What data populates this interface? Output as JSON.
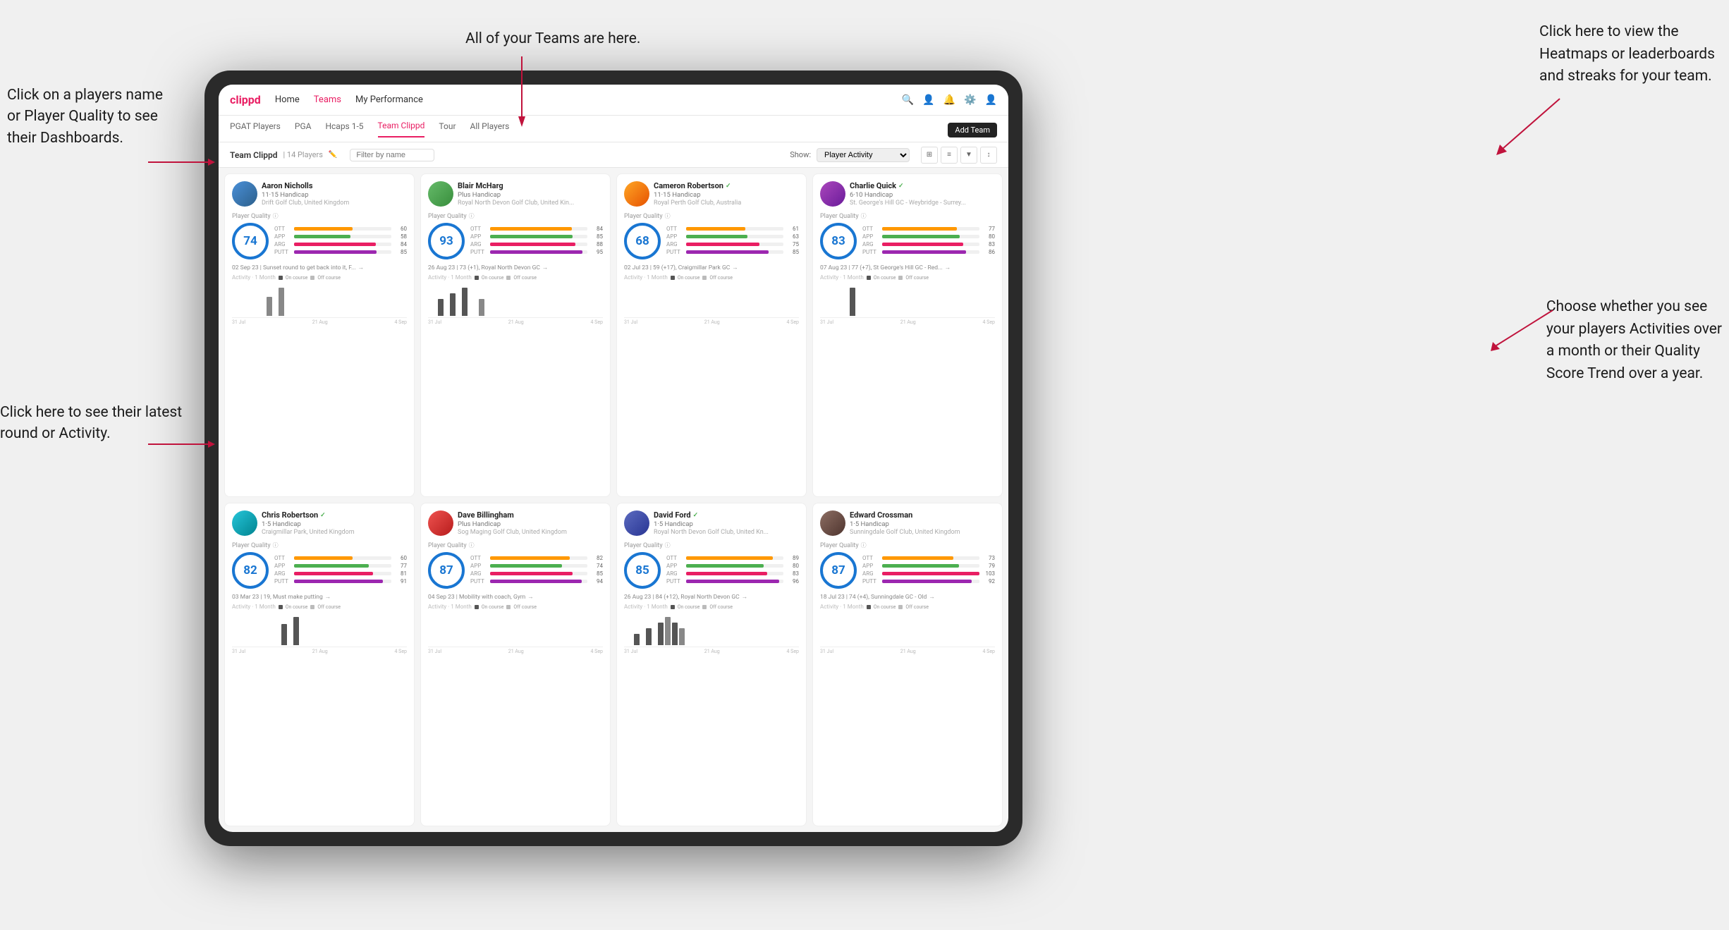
{
  "annotations": {
    "top_center": "All of your Teams are here.",
    "top_right": "Click here to view the\nHeatmaps or leaderboards\nand streaks for your team.",
    "left_top": "Click on a players name\nor Player Quality to see\ntheir Dashboards.",
    "left_bottom": "Click here to see their latest\nround or Activity.",
    "right_bottom": "Choose whether you see\nyour players Activities over\na month or their Quality\nScore Trend over a year."
  },
  "nav": {
    "logo": "clippd",
    "links": [
      "Home",
      "Teams",
      "My Performance"
    ],
    "active_link": "Teams"
  },
  "sub_tabs": {
    "tabs": [
      "PGAT Players",
      "PGA",
      "Hcaps 1-5",
      "Team Clippd",
      "Tour",
      "All Players"
    ],
    "active": "Team Clippd"
  },
  "team_header": {
    "title": "Team Clippd",
    "count": "14 Players",
    "filter_placeholder": "Filter by name",
    "show_label": "Show:",
    "show_option": "Player Activity",
    "add_team": "Add Team"
  },
  "players": [
    {
      "name": "Aaron Nicholls",
      "handicap": "11·15 Handicap",
      "club": "Drift Golf Club, United Kingdom",
      "quality": 74,
      "quality_color": "#1976d2",
      "stats": [
        {
          "label": "OTT",
          "value": 60,
          "color": "#ff9800"
        },
        {
          "label": "APP",
          "value": 58,
          "color": "#4caf50"
        },
        {
          "label": "ARG",
          "value": 84,
          "color": "#e91e63"
        },
        {
          "label": "PUTT",
          "value": 85,
          "color": "#9c27b0"
        }
      ],
      "recent": "02 Sep 23 | Sunset round to get back into it, F...",
      "avatar_class": "av-blue",
      "verified": false,
      "bars": [
        0,
        0,
        0,
        0,
        0,
        0,
        0,
        2,
        0,
        3,
        0,
        0,
        0,
        0
      ]
    },
    {
      "name": "Blair McHarg",
      "handicap": "Plus Handicap",
      "club": "Royal North Devon Golf Club, United Kin...",
      "quality": 93,
      "quality_color": "#1976d2",
      "stats": [
        {
          "label": "OTT",
          "value": 84,
          "color": "#ff9800"
        },
        {
          "label": "APP",
          "value": 85,
          "color": "#4caf50"
        },
        {
          "label": "ARG",
          "value": 88,
          "color": "#e91e63"
        },
        {
          "label": "PUTT",
          "value": 95,
          "color": "#9c27b0"
        }
      ],
      "recent": "26 Aug 23 | 73 (+1), Royal North Devon GC",
      "avatar_class": "av-green",
      "verified": false,
      "bars": [
        0,
        0,
        3,
        0,
        4,
        0,
        5,
        0,
        0,
        3,
        0,
        0,
        0,
        0
      ]
    },
    {
      "name": "Cameron Robertson",
      "handicap": "11·15 Handicap",
      "club": "Royal Perth Golf Club, Australia",
      "quality": 68,
      "quality_color": "#1976d2",
      "stats": [
        {
          "label": "OTT",
          "value": 61,
          "color": "#ff9800"
        },
        {
          "label": "APP",
          "value": 63,
          "color": "#4caf50"
        },
        {
          "label": "ARG",
          "value": 75,
          "color": "#e91e63"
        },
        {
          "label": "PUTT",
          "value": 85,
          "color": "#9c27b0"
        }
      ],
      "recent": "02 Jul 23 | 59 (+17), Craigmillar Park GC",
      "avatar_class": "av-orange",
      "verified": true,
      "bars": [
        0,
        0,
        0,
        0,
        0,
        0,
        0,
        0,
        0,
        0,
        0,
        0,
        0,
        0
      ]
    },
    {
      "name": "Charlie Quick",
      "handicap": "6·10 Handicap",
      "club": "St. George's Hill GC - Weybridge - Surrey...",
      "quality": 83,
      "quality_color": "#1976d2",
      "stats": [
        {
          "label": "OTT",
          "value": 77,
          "color": "#ff9800"
        },
        {
          "label": "APP",
          "value": 80,
          "color": "#4caf50"
        },
        {
          "label": "ARG",
          "value": 83,
          "color": "#e91e63"
        },
        {
          "label": "PUTT",
          "value": 86,
          "color": "#9c27b0"
        }
      ],
      "recent": "07 Aug 23 | 77 (+7), St George's Hill GC - Red...",
      "avatar_class": "av-purple",
      "verified": true,
      "bars": [
        0,
        0,
        0,
        0,
        0,
        0,
        2,
        0,
        0,
        0,
        0,
        0,
        0,
        0
      ]
    },
    {
      "name": "Chris Robertson",
      "handicap": "1·5 Handicap",
      "club": "Craigmillar Park, United Kingdom",
      "quality": 82,
      "quality_color": "#1976d2",
      "stats": [
        {
          "label": "OTT",
          "value": 60,
          "color": "#ff9800"
        },
        {
          "label": "APP",
          "value": 77,
          "color": "#4caf50"
        },
        {
          "label": "ARG",
          "value": 81,
          "color": "#e91e63"
        },
        {
          "label": "PUTT",
          "value": 91,
          "color": "#9c27b0"
        }
      ],
      "recent": "03 Mar 23 | 19, Must make putting",
      "avatar_class": "av-teal",
      "verified": true,
      "bars": [
        0,
        0,
        0,
        0,
        0,
        0,
        0,
        0,
        0,
        0,
        3,
        0,
        4,
        0
      ]
    },
    {
      "name": "Dave Billingham",
      "handicap": "Plus Handicap",
      "club": "Sog Maging Golf Club, United Kingdom",
      "quality": 87,
      "quality_color": "#1976d2",
      "stats": [
        {
          "label": "OTT",
          "value": 82,
          "color": "#ff9800"
        },
        {
          "label": "APP",
          "value": 74,
          "color": "#4caf50"
        },
        {
          "label": "ARG",
          "value": 85,
          "color": "#e91e63"
        },
        {
          "label": "PUTT",
          "value": 94,
          "color": "#9c27b0"
        }
      ],
      "recent": "04 Sep 23 | Mobility with coach, Gym",
      "avatar_class": "av-red",
      "verified": false,
      "bars": [
        0,
        0,
        0,
        0,
        0,
        0,
        0,
        0,
        0,
        0,
        0,
        0,
        0,
        0
      ]
    },
    {
      "name": "David Ford",
      "handicap": "1·5 Handicap",
      "club": "Royal North Devon Golf Club, United Kn...",
      "quality": 85,
      "quality_color": "#1976d2",
      "stats": [
        {
          "label": "OTT",
          "value": 89,
          "color": "#ff9800"
        },
        {
          "label": "APP",
          "value": 80,
          "color": "#4caf50"
        },
        {
          "label": "ARG",
          "value": 83,
          "color": "#e91e63"
        },
        {
          "label": "PUTT",
          "value": 96,
          "color": "#9c27b0"
        }
      ],
      "recent": "26 Aug 23 | 84 (+12), Royal North Devon GC",
      "avatar_class": "av-navy",
      "verified": true,
      "bars": [
        0,
        0,
        2,
        0,
        3,
        0,
        4,
        5,
        4,
        3,
        0,
        0,
        0,
        0
      ]
    },
    {
      "name": "Edward Crossman",
      "handicap": "1·5 Handicap",
      "club": "Sunningdale Golf Club, United Kingdom",
      "quality": 87,
      "quality_color": "#1976d2",
      "stats": [
        {
          "label": "OTT",
          "value": 73,
          "color": "#ff9800"
        },
        {
          "label": "APP",
          "value": 79,
          "color": "#4caf50"
        },
        {
          "label": "ARG",
          "value": 103,
          "color": "#e91e63"
        },
        {
          "label": "PUTT",
          "value": 92,
          "color": "#9c27b0"
        }
      ],
      "recent": "18 Jul 23 | 74 (+4), Sunningdale GC - Old",
      "avatar_class": "av-brown",
      "verified": false,
      "bars": [
        0,
        0,
        0,
        0,
        0,
        0,
        0,
        0,
        0,
        0,
        0,
        0,
        0,
        0
      ]
    }
  ]
}
